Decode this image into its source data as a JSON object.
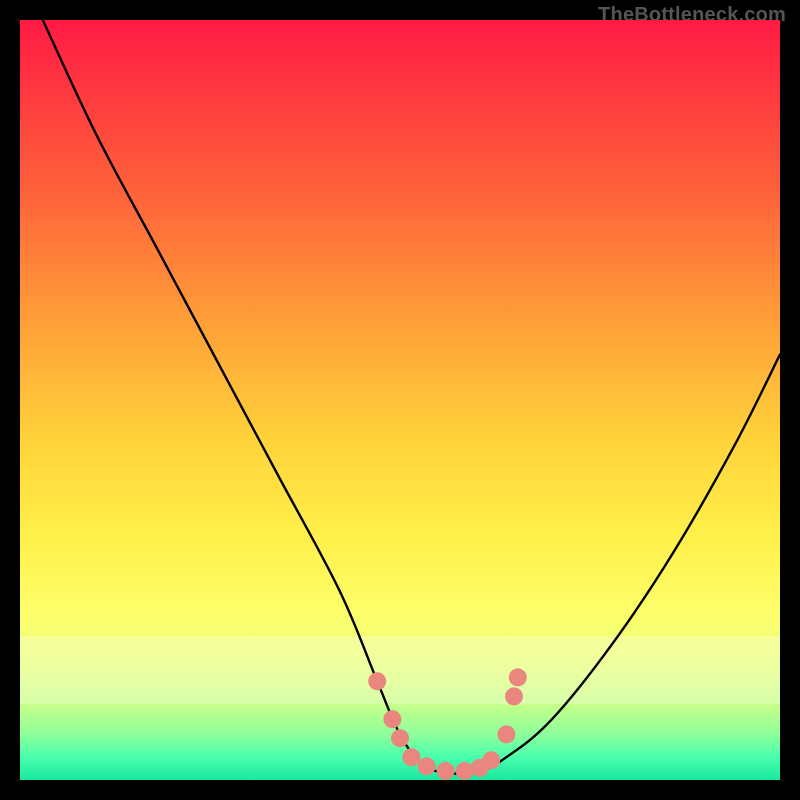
{
  "watermark": "TheBottleneck.com",
  "chart_data": {
    "type": "line",
    "title": "",
    "xlabel": "",
    "ylabel": "",
    "xlim": [
      0,
      100
    ],
    "ylim": [
      0,
      100
    ],
    "grid": false,
    "legend": false,
    "series": [
      {
        "name": "bottleneck-curve",
        "x": [
          3,
          10,
          18,
          26,
          34,
          42,
          47,
          50,
          53,
          56,
          60,
          64,
          70,
          78,
          86,
          94,
          100
        ],
        "values": [
          100,
          85,
          70,
          55,
          40,
          25,
          13,
          6,
          2,
          1,
          1,
          3,
          8,
          18,
          30,
          44,
          56
        ]
      }
    ],
    "markers": {
      "name": "highlight-dots",
      "color": "#e9877f",
      "points": [
        {
          "x": 47.0,
          "y": 13.0
        },
        {
          "x": 49.0,
          "y": 8.0
        },
        {
          "x": 50.0,
          "y": 5.5
        },
        {
          "x": 51.5,
          "y": 3.0
        },
        {
          "x": 53.5,
          "y": 1.8
        },
        {
          "x": 56.0,
          "y": 1.2
        },
        {
          "x": 58.5,
          "y": 1.2
        },
        {
          "x": 60.5,
          "y": 1.6
        },
        {
          "x": 62.0,
          "y": 2.6
        },
        {
          "x": 64.0,
          "y": 6.0
        },
        {
          "x": 65.0,
          "y": 11.0
        },
        {
          "x": 65.5,
          "y": 13.5
        }
      ]
    },
    "gradient_stops": [
      {
        "pos": 0.0,
        "color": "#ff1a44"
      },
      {
        "pos": 0.1,
        "color": "#ff3a3f"
      },
      {
        "pos": 0.25,
        "color": "#ff6a3a"
      },
      {
        "pos": 0.4,
        "color": "#ffa038"
      },
      {
        "pos": 0.55,
        "color": "#ffd23a"
      },
      {
        "pos": 0.68,
        "color": "#fff04a"
      },
      {
        "pos": 0.78,
        "color": "#fdff6a"
      },
      {
        "pos": 0.85,
        "color": "#e8ff7a"
      },
      {
        "pos": 0.9,
        "color": "#c8ff8a"
      },
      {
        "pos": 0.94,
        "color": "#8cff9a"
      },
      {
        "pos": 0.97,
        "color": "#4affad"
      },
      {
        "pos": 1.0,
        "color": "#18e8a0"
      }
    ]
  }
}
